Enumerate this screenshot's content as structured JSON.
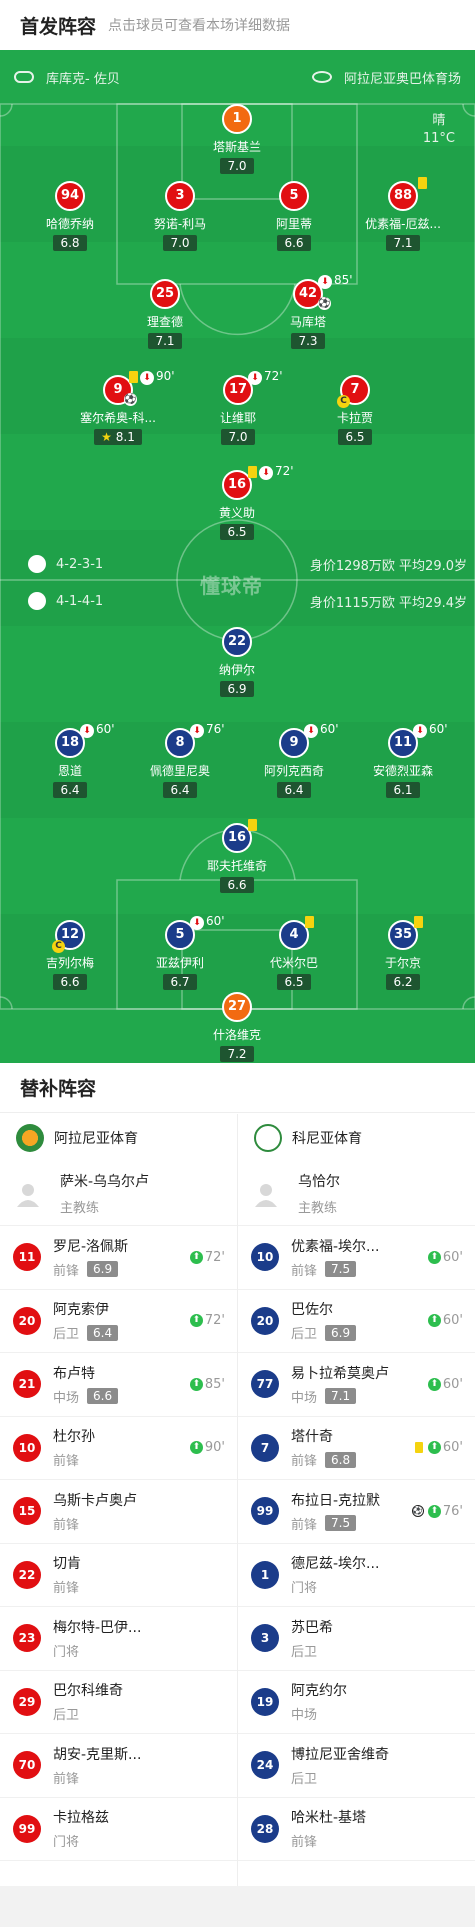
{
  "header": {
    "title": "首发阵容",
    "subtitle": "点击球员可查看本场详细数据"
  },
  "match": {
    "referee": "库库克- 佐贝",
    "stadium": "阿拉尼亚奥巴体育场",
    "weather": "晴",
    "temperature": "11°C",
    "watermark": "懂球帝"
  },
  "home": {
    "formation": "4-2-3-1",
    "value_avg": "身价1298万欧 平均29.0岁",
    "players": [
      {
        "num": "1",
        "name": "塔斯基兰",
        "rating": "7.0"
      },
      {
        "num": "94",
        "name": "哈德乔纳",
        "rating": "6.8"
      },
      {
        "num": "3",
        "name": "努诺-利马",
        "rating": "7.0"
      },
      {
        "num": "5",
        "name": "阿里蒂",
        "rating": "6.6"
      },
      {
        "num": "88",
        "name": "优素福-厄兹...",
        "rating": "7.1"
      },
      {
        "num": "25",
        "name": "理查德",
        "rating": "7.1"
      },
      {
        "num": "42",
        "name": "马库塔",
        "rating": "7.3",
        "sub": "85'"
      },
      {
        "num": "9",
        "name": "塞尔希奥-科...",
        "rating": "8.1",
        "sub": "90'"
      },
      {
        "num": "17",
        "name": "让维耶",
        "rating": "7.0",
        "sub": "72'"
      },
      {
        "num": "7",
        "name": "卡拉贾",
        "rating": "6.5"
      },
      {
        "num": "16",
        "name": "黄义助",
        "rating": "6.5",
        "sub": "72'"
      }
    ]
  },
  "away": {
    "formation": "4-1-4-1",
    "value_avg": "身价1115万欧 平均29.4岁",
    "players": [
      {
        "num": "22",
        "name": "纳伊尔",
        "rating": "6.9"
      },
      {
        "num": "18",
        "name": "恩道",
        "rating": "6.4",
        "sub": "60'"
      },
      {
        "num": "8",
        "name": "佩德里尼奥",
        "rating": "6.4",
        "sub": "76'"
      },
      {
        "num": "9",
        "name": "阿列克西奇",
        "rating": "6.4",
        "sub": "60'"
      },
      {
        "num": "11",
        "name": "安德烈亚森",
        "rating": "6.1",
        "sub": "60'"
      },
      {
        "num": "16",
        "name": "耶夫托维奇",
        "rating": "6.6"
      },
      {
        "num": "12",
        "name": "吉列尔梅",
        "rating": "6.6"
      },
      {
        "num": "5",
        "name": "亚兹伊利",
        "rating": "6.7",
        "sub": "60'"
      },
      {
        "num": "4",
        "name": "代米尔巴",
        "rating": "6.5"
      },
      {
        "num": "35",
        "name": "于尔京",
        "rating": "6.2"
      },
      {
        "num": "27",
        "name": "什洛维克",
        "rating": "7.2"
      }
    ]
  },
  "subs": {
    "title": "替补阵容",
    "home_team": "阿拉尼亚体育",
    "away_team": "科尼亚体育",
    "home_coach": {
      "name": "萨米-乌乌尔卢",
      "role": "主教练"
    },
    "away_coach": {
      "name": "乌恰尔",
      "role": "主教练"
    },
    "home_list": [
      {
        "num": "11",
        "name": "罗尼-洛佩斯",
        "pos": "前锋",
        "rating": "6.9",
        "in": "72'"
      },
      {
        "num": "20",
        "name": "阿克索伊",
        "pos": "后卫",
        "rating": "6.4",
        "in": "72'"
      },
      {
        "num": "21",
        "name": "布卢特",
        "pos": "中场",
        "rating": "6.6",
        "in": "85'"
      },
      {
        "num": "10",
        "name": "杜尔孙",
        "pos": "前锋",
        "rating": "",
        "in": "90'"
      },
      {
        "num": "15",
        "name": "乌斯卡卢奥卢",
        "pos": "前锋",
        "rating": "",
        "in": ""
      },
      {
        "num": "22",
        "name": "切肯",
        "pos": "前锋",
        "rating": "",
        "in": ""
      },
      {
        "num": "23",
        "name": "梅尔特-巴伊...",
        "pos": "门将",
        "rating": "",
        "in": ""
      },
      {
        "num": "29",
        "name": "巴尔科维奇",
        "pos": "后卫",
        "rating": "",
        "in": ""
      },
      {
        "num": "70",
        "name": "胡安-克里斯...",
        "pos": "前锋",
        "rating": "",
        "in": ""
      },
      {
        "num": "99",
        "name": "卡拉格兹",
        "pos": "门将",
        "rating": "",
        "in": ""
      }
    ],
    "away_list": [
      {
        "num": "10",
        "name": "优素福-埃尔...",
        "pos": "前锋",
        "rating": "7.5",
        "in": "60'"
      },
      {
        "num": "20",
        "name": "巴佐尔",
        "pos": "后卫",
        "rating": "6.9",
        "in": "60'"
      },
      {
        "num": "77",
        "name": "易卜拉希莫奥卢",
        "pos": "中场",
        "rating": "7.1",
        "in": "60'"
      },
      {
        "num": "7",
        "name": "塔什奇",
        "pos": "前锋",
        "rating": "6.8",
        "in": "60'",
        "yellow": true
      },
      {
        "num": "99",
        "name": "布拉日-克拉默",
        "pos": "前锋",
        "rating": "7.5",
        "in": "76'",
        "goal": true
      },
      {
        "num": "1",
        "name": "德尼兹-埃尔...",
        "pos": "门将",
        "rating": "",
        "in": ""
      },
      {
        "num": "3",
        "name": "苏巴希",
        "pos": "后卫",
        "rating": "",
        "in": ""
      },
      {
        "num": "19",
        "name": "阿克约尔",
        "pos": "中场",
        "rating": "",
        "in": ""
      },
      {
        "num": "24",
        "name": "博拉尼亚舍维奇",
        "pos": "后卫",
        "rating": "",
        "in": ""
      },
      {
        "num": "28",
        "name": "哈米杜-基塔",
        "pos": "前锋",
        "rating": "",
        "in": ""
      }
    ]
  },
  "colors": {
    "pitch": "#1fa149",
    "home": "#e10f12",
    "away": "#1b3c8a",
    "keeper": "#f26a11",
    "sub_in": "#2dbe4e",
    "yellow": "#f5d30f"
  }
}
